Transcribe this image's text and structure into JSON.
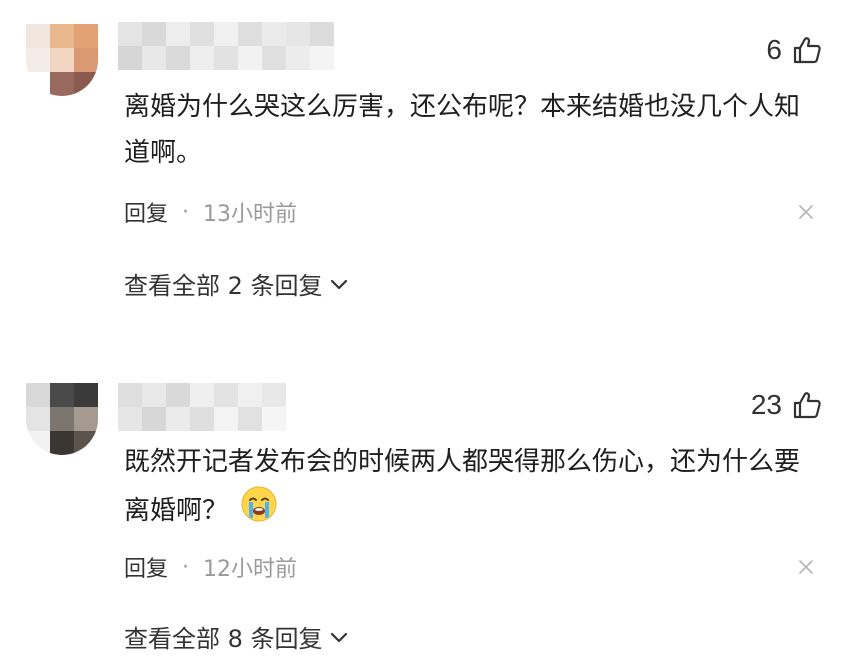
{
  "comments": [
    {
      "likes": "6",
      "text": "离婚为什么哭这么厉害，还公布呢？本来结婚也没几个人知道啊。",
      "reply_label": "回复",
      "separator": "·",
      "time": "13小时前",
      "view_replies": "查看全部 2 条回复",
      "avatar_colors": [
        "#f1e7df",
        "#e9b88f",
        "#e2a274",
        "#f4ece6",
        "#efd5c2",
        "#d99a73",
        "#ffffff",
        "#9b6a5e",
        "#8a5a4e"
      ]
    },
    {
      "likes": "23",
      "text": "既然开记者发布会的时候两人都哭得那么伤心，还为什么要离婚啊？",
      "emoji": "crying-face",
      "reply_label": "回复",
      "separator": "·",
      "time": "12小时前",
      "view_replies": "查看全部 8 条回复",
      "avatar_colors": [
        "#d8d8d8",
        "#4a4a4a",
        "#3a3a3a",
        "#e4e4e4",
        "#7d766f",
        "#a49a90",
        "#f2f2f2",
        "#3a3632",
        "#5b534c"
      ]
    }
  ],
  "icons": {
    "like": "thumbs-up-icon",
    "close": "close-icon",
    "expand": "chevron-down-icon"
  },
  "colors": {
    "text": "#1f1f1f",
    "meta": "#9a9a9a",
    "emoji_face": "#ffd54a",
    "emoji_tears": "#4fb3f0"
  }
}
